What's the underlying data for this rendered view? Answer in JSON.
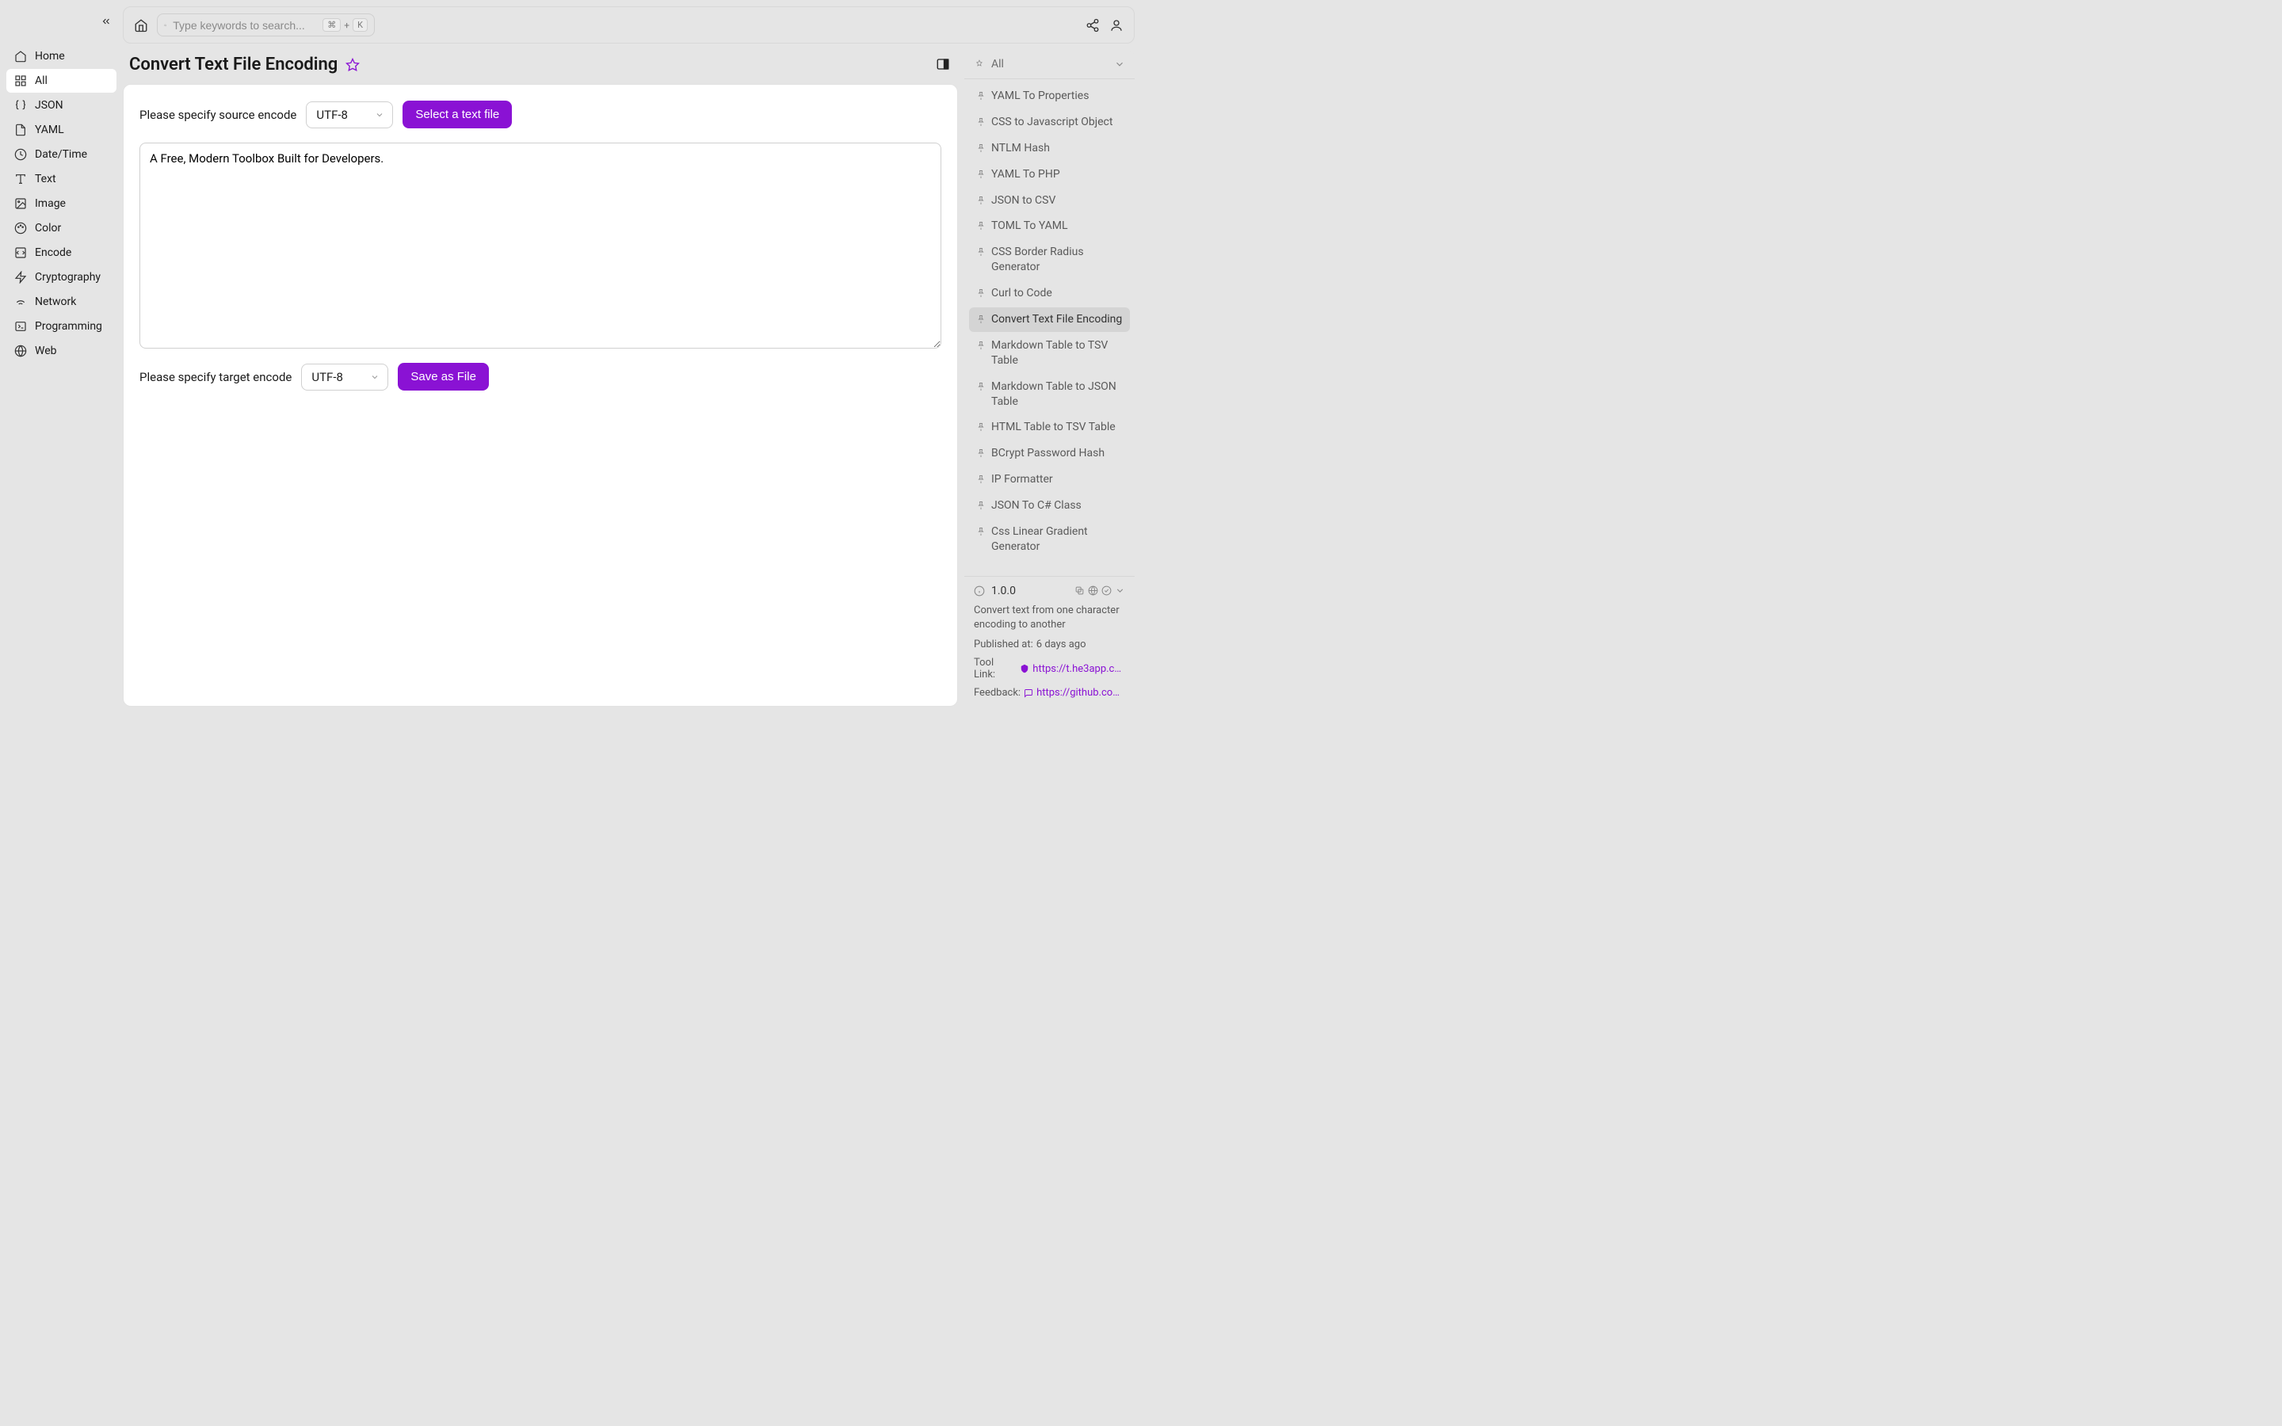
{
  "sidebar": {
    "items": [
      {
        "icon": "home",
        "label": "Home"
      },
      {
        "icon": "grid",
        "label": "All"
      },
      {
        "icon": "braces",
        "label": "JSON"
      },
      {
        "icon": "file",
        "label": "YAML"
      },
      {
        "icon": "clock",
        "label": "Date/Time"
      },
      {
        "icon": "text",
        "label": "Text"
      },
      {
        "icon": "image",
        "label": "Image"
      },
      {
        "icon": "palette",
        "label": "Color"
      },
      {
        "icon": "code",
        "label": "Encode"
      },
      {
        "icon": "zap",
        "label": "Cryptography"
      },
      {
        "icon": "wifi",
        "label": "Network"
      },
      {
        "icon": "terminal",
        "label": "Programming"
      },
      {
        "icon": "globe",
        "label": "Web"
      }
    ],
    "active_index": 1
  },
  "search": {
    "placeholder": "Type keywords to search...",
    "shortcut_mod": "⌘",
    "shortcut_plus": "+",
    "shortcut_key": "K"
  },
  "page": {
    "title": "Convert Text File Encoding"
  },
  "form": {
    "source_label": "Please specify source encode",
    "source_value": "UTF-8",
    "select_file_btn": "Select a text file",
    "textarea_value": "A Free, Modern Toolbox Built for Developers.",
    "target_label": "Please specify target encode",
    "target_value": "UTF-8",
    "save_btn": "Save as File"
  },
  "right": {
    "header_label": "All",
    "tools": [
      "YAML To Properties",
      "CSS to Javascript Object",
      "NTLM Hash",
      "YAML To PHP",
      "JSON to CSV",
      "TOML To YAML",
      "CSS Border Radius Generator",
      "Curl to Code",
      "Convert Text File Encoding",
      "Markdown Table to TSV Table",
      "Markdown Table to JSON Table",
      "HTML Table to TSV Table",
      "BCrypt Password Hash",
      "IP Formatter",
      "JSON To C# Class",
      "Css Linear Gradient Generator"
    ],
    "active_tool_index": 8
  },
  "info": {
    "version": "1.0.0",
    "description": "Convert text from one character encoding to another",
    "published_label": "Published at:",
    "published_value": "6 days ago",
    "tool_link_label": "Tool Link:",
    "tool_link_value": "https://t.he3app.co…",
    "feedback_label": "Feedback:",
    "feedback_value": "https://github.com/…"
  }
}
